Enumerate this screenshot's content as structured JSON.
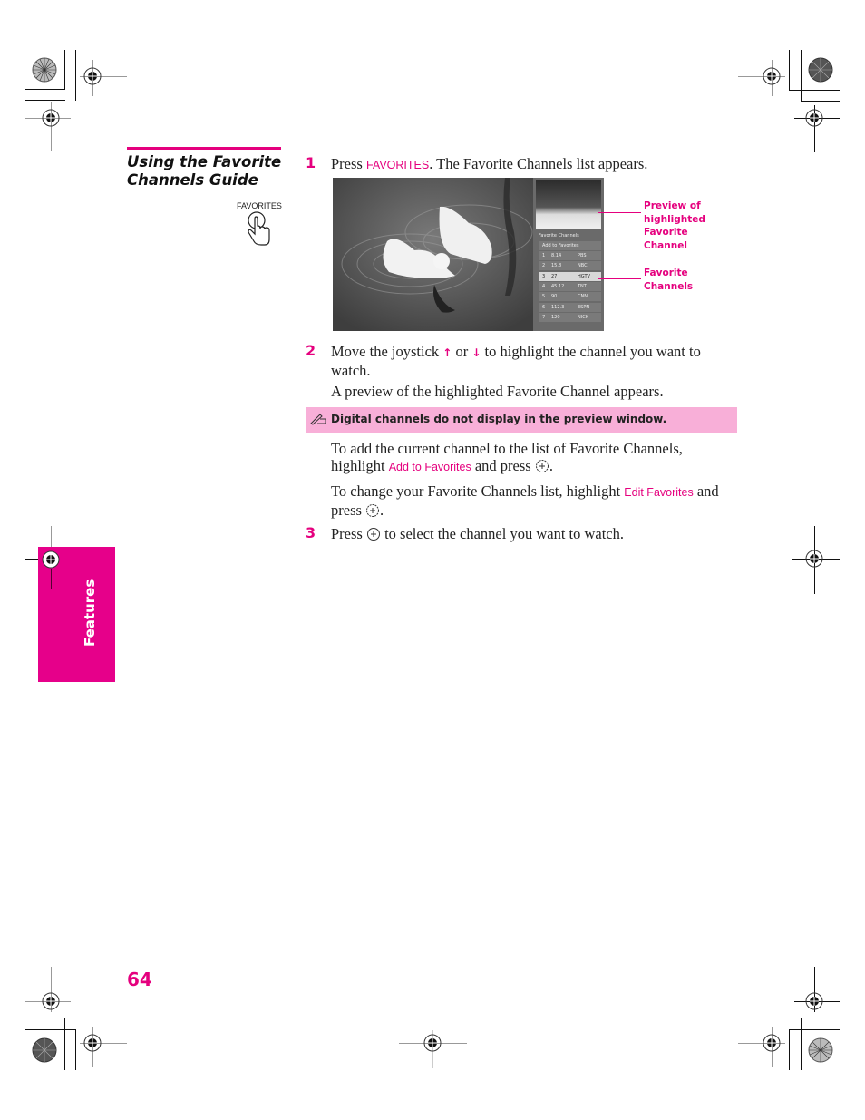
{
  "section": {
    "title_line1": "Using the Favorite",
    "title_line2": "Channels Guide",
    "button_label": "FAVORITES",
    "button_icon": "pointing-hand-icon"
  },
  "steps": [
    {
      "number": "1",
      "text_before": "Press ",
      "key": "FAVORITES",
      "text_after": ". The Favorite Channels list appears."
    },
    {
      "number": "2",
      "line1_a": "Move the joystick ",
      "up_arrow": "↑",
      "line1_b": " or ",
      "down_arrow": "↓",
      "line1_c": " to highlight the channel you want to",
      "line2": "watch.",
      "para2": "A preview of the highlighted Favorite Channel appears."
    },
    {
      "number": "3",
      "text_before": "Press ",
      "text_after": " to select the channel you want to watch."
    }
  ],
  "note": {
    "icon": "pencil-note-icon",
    "text": "Digital channels do not display in the preview window."
  },
  "add_para": {
    "line1": "To add the current channel to the list of Favorite Channels,",
    "line2_a": "highlight ",
    "line2_key": "Add to Favorites",
    "line2_b": " and press ",
    "line2_c": "."
  },
  "edit_para": {
    "line1_a": "To change your Favorite Channels list, highlight ",
    "line1_key": "Edit Favorites",
    "line1_b": " and",
    "line2_a": "press ",
    "line2_b": "."
  },
  "screen": {
    "osd_title": "Favorite Channels",
    "add_item": "Add to Favorites",
    "channels": [
      {
        "num": "1",
        "ch": "8.14",
        "name": "PBS"
      },
      {
        "num": "2",
        "ch": "15.8",
        "name": "NBC"
      },
      {
        "num": "3",
        "ch": "27",
        "name": "HGTV"
      },
      {
        "num": "4",
        "ch": "45.12",
        "name": "TNT"
      },
      {
        "num": "5",
        "ch": "90",
        "name": "CNN"
      },
      {
        "num": "6",
        "ch": "112.3",
        "name": "ESPN"
      },
      {
        "num": "7",
        "ch": "120",
        "name": "NICK"
      }
    ],
    "highlighted_index": 2
  },
  "callouts": {
    "preview": [
      "Preview of",
      "highlighted",
      "Favorite",
      "Channel"
    ],
    "list": [
      "Favorite",
      "Channels"
    ]
  },
  "side_tab": "Features",
  "page_number": "64",
  "colors": {
    "accent": "#e5007e",
    "note_bg": "#f8afd8",
    "tab_bg": "#e6008a"
  }
}
